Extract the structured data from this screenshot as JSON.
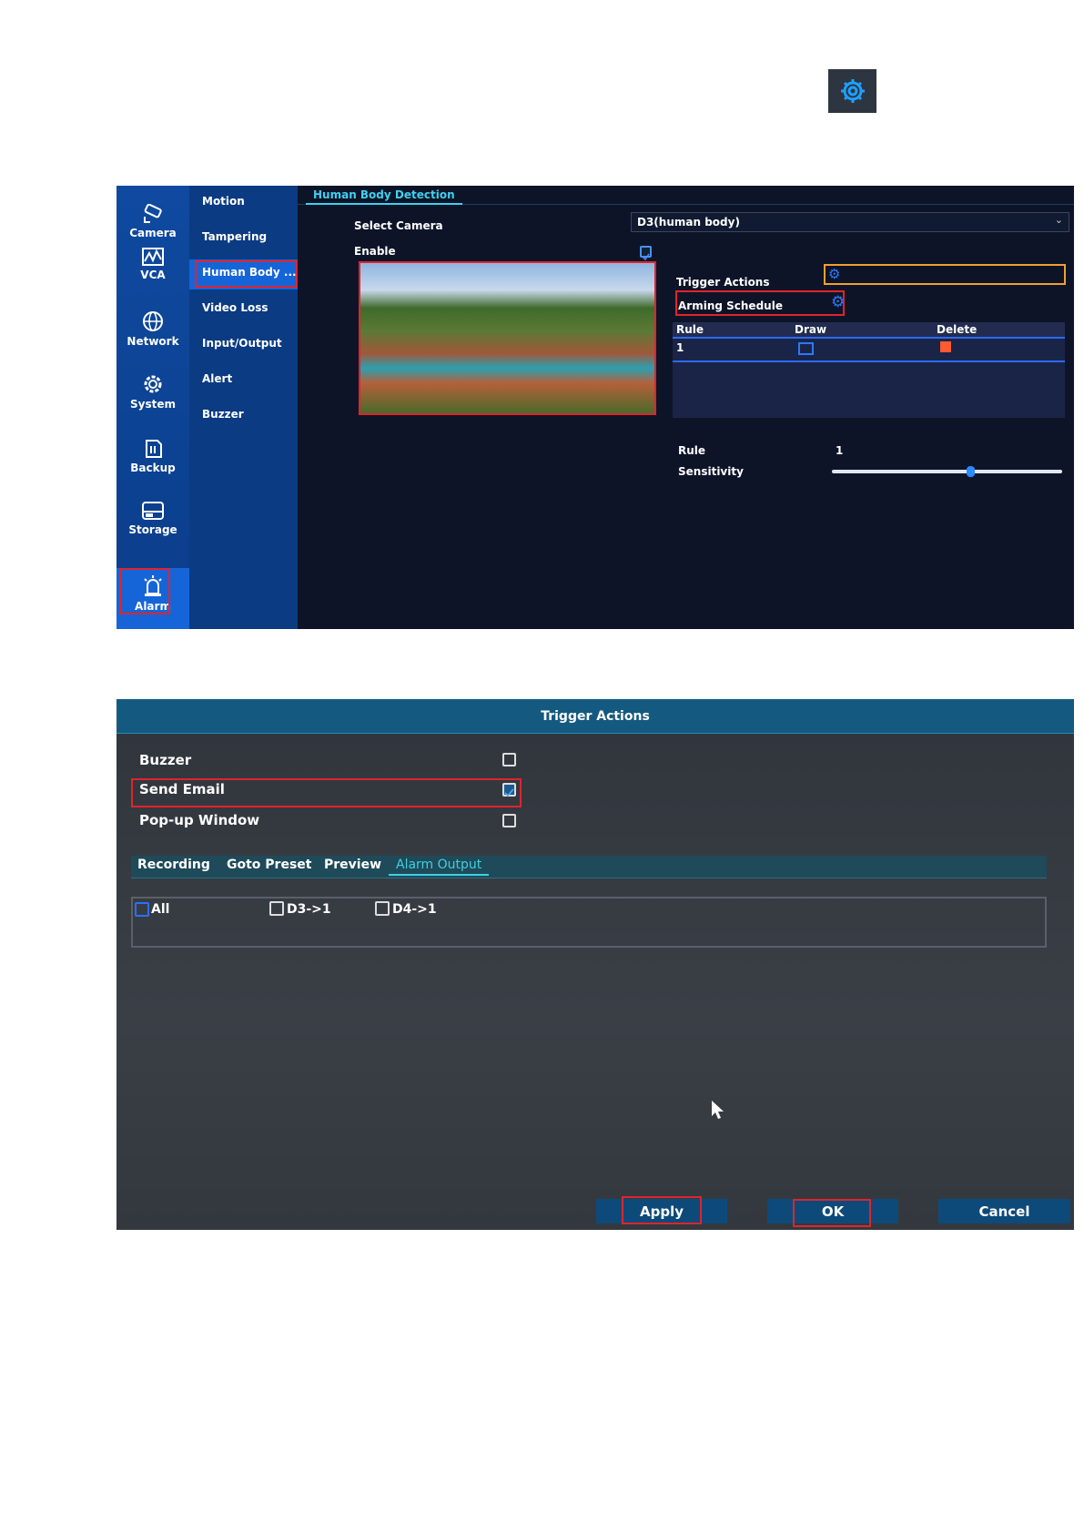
{
  "top_icon": "gear-icon",
  "settings": {
    "sidebar": [
      {
        "label": "Camera",
        "icon": "camera-icon"
      },
      {
        "label": "VCA",
        "icon": "vca-icon"
      },
      {
        "label": "Network",
        "icon": "globe-icon"
      },
      {
        "label": "System",
        "icon": "gear-icon"
      },
      {
        "label": "Backup",
        "icon": "backup-icon"
      },
      {
        "label": "Storage",
        "icon": "storage-icon"
      },
      {
        "label": "Alarm",
        "icon": "alarm-icon",
        "active": true
      }
    ],
    "submenu": [
      {
        "label": "Motion"
      },
      {
        "label": "Tampering"
      },
      {
        "label": "Human Body ...",
        "active": true
      },
      {
        "label": "Video Loss"
      },
      {
        "label": "Input/Output"
      },
      {
        "label": "Alert"
      },
      {
        "label": "Buzzer"
      }
    ],
    "tab": "Human Body Detection",
    "select_camera_label": "Select Camera",
    "select_camera_value": "D3(human body)",
    "enable_label": "Enable",
    "enable_checked": true,
    "trigger_actions_label": "Trigger Actions",
    "arming_schedule_label": "Arming Schedule",
    "table": {
      "headers": [
        "Rule",
        "Draw",
        "Delete"
      ],
      "rows": [
        {
          "rule": "1"
        }
      ]
    },
    "rule_label": "Rule",
    "rule_value": "1",
    "sensitivity_label": "Sensitivity",
    "sensitivity_fraction": 0.6
  },
  "dialog": {
    "title": "Trigger Actions",
    "options": [
      {
        "label": "Buzzer",
        "checked": false
      },
      {
        "label": "Send Email",
        "checked": true
      },
      {
        "label": "Pop-up Window",
        "checked": false
      }
    ],
    "tabs": [
      {
        "label": "Recording"
      },
      {
        "label": "Goto Preset"
      },
      {
        "label": "Preview"
      },
      {
        "label": "Alarm Output",
        "active": true
      }
    ],
    "outputs": [
      {
        "label": "All"
      },
      {
        "label": "D3->1"
      },
      {
        "label": "D4->1"
      }
    ],
    "buttons": {
      "apply": "Apply",
      "ok": "OK",
      "cancel": "Cancel"
    }
  },
  "colors": {
    "accent": "#1e90ff",
    "highlight": "#e0242c",
    "focus": "#f0a030",
    "tab_active": "#3fd0e0"
  }
}
